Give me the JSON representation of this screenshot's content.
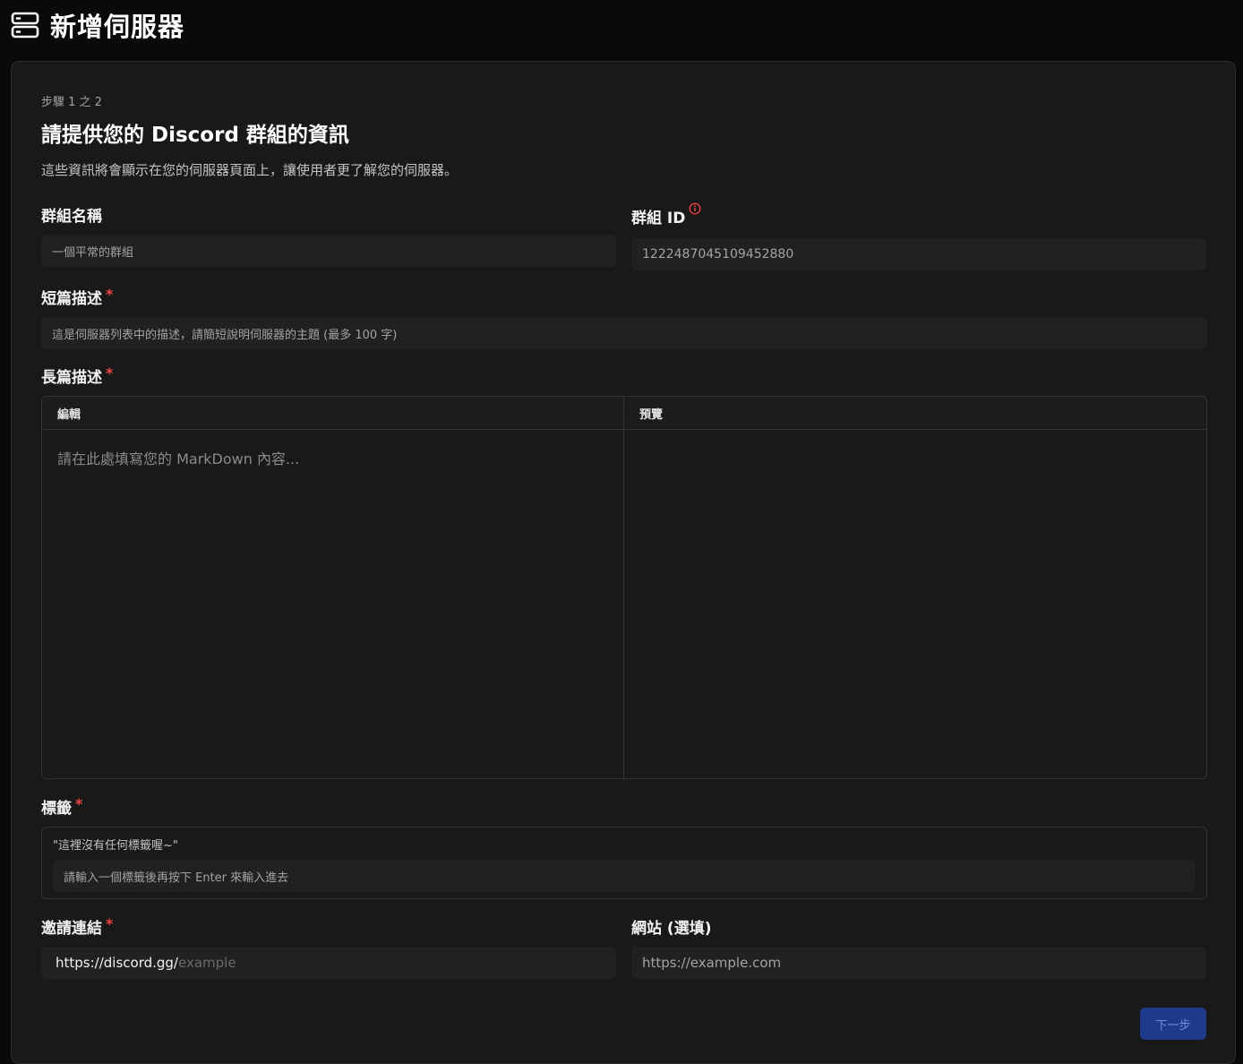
{
  "header": {
    "icon": "server-icon",
    "title": "新增伺服器"
  },
  "form": {
    "step_text": "步驟 1 之 2",
    "heading": "請提供您的 Discord 群組的資訊",
    "description": "這些資訊將會顯示在您的伺服器頁面上，讓使用者更了解您的伺服器。",
    "group_name": {
      "label": "群組名稱",
      "placeholder": "一個平常的群組"
    },
    "group_id": {
      "label": "群組 ID",
      "value": "1222487045109452880"
    },
    "short_description": {
      "label": "短篇描述",
      "required_mark": "*",
      "placeholder": "這是伺服器列表中的描述，請簡短說明伺服器的主題 (最多 100 字)"
    },
    "long_description": {
      "label": "長篇描述",
      "required_mark": "*",
      "edit_tab": "編輯",
      "preview_tab": "預覽",
      "placeholder": "請在此處填寫您的 MarkDown 內容..."
    },
    "tags": {
      "label": "標籤",
      "required_mark": "*",
      "empty_text": "\"這裡沒有任何標籤喔~\"",
      "placeholder": "請輸入一個標籤後再按下 Enter 來輸入進去"
    },
    "invite_link": {
      "label": "邀請連結",
      "required_mark": "*",
      "prefix": "https://discord.gg/",
      "placeholder": "example"
    },
    "website": {
      "label": "網站 (選填)",
      "placeholder": "https://example.com"
    },
    "next_button": "下一步"
  },
  "colors": {
    "background": "#0a0a0a",
    "card": "#191919",
    "input": "#212121",
    "required": "#ef4444",
    "button": "#1e3a8a"
  }
}
